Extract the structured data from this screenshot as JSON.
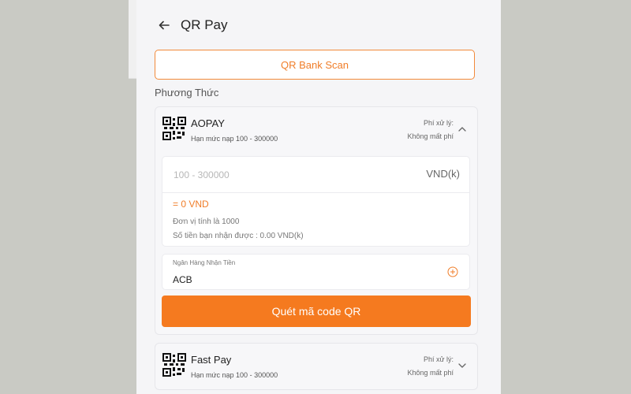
{
  "header": {
    "title": "QR Pay",
    "back_icon": "arrow-left-icon"
  },
  "tab": {
    "label": "QR Bank Scan",
    "accent": "#f07d28"
  },
  "methods_section": {
    "label": "Phương Thức"
  },
  "methods": [
    {
      "name": "AOPAY",
      "limit": "Hạn mức nạp 100 - 300000",
      "fee_label": "Phí xử lý:",
      "fee_value": "Không mất phí",
      "icon": "qr-code-icon",
      "expanded": true,
      "amount_placeholder": "100 - 300000",
      "amount_value": "",
      "unit": "VND(k)",
      "converted": "= 0 VND",
      "unit_note": "Đơn vị tính là 1000",
      "receive_note": "Số tiền bạn nhận được : 0.00 VND(k)",
      "bank_label": "Ngân Hàng Nhận Tiền",
      "bank_value": "ACB",
      "submit_label": "Quét mã code QR"
    },
    {
      "name": "Fast Pay",
      "limit": "Hạn mức nạp 100 - 300000",
      "fee_label": "Phí xử lý:",
      "fee_value": "Không mất phí",
      "icon": "qr-code-icon",
      "expanded": false
    }
  ],
  "colors": {
    "primary": "#f57a1f",
    "background": "#c9cac4",
    "panel": "#f5f5f7"
  }
}
